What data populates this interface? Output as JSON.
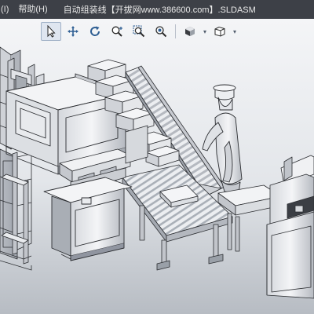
{
  "menu": {
    "items": [
      "(I)",
      "帮助(H)"
    ],
    "document_title": "自动组装线【开拔网www.386600.com】.SLDASM"
  },
  "heads_up_toolbar": {
    "tools": [
      {
        "name": "select",
        "icon": "cursor-arrow-icon",
        "active": true
      },
      {
        "name": "move",
        "icon": "pan-arrows-icon",
        "active": false
      },
      {
        "name": "rotate",
        "icon": "rotate-view-icon",
        "active": false
      },
      {
        "name": "zoom-in-out",
        "icon": "zoom-in-out-icon",
        "active": false
      },
      {
        "name": "zoom-to-area",
        "icon": "zoom-area-icon",
        "active": false
      },
      {
        "name": "zoom-to-fit",
        "icon": "zoom-fit-icon",
        "active": false
      },
      {
        "name": "display-style",
        "icon": "display-style-icon",
        "active": false
      },
      {
        "name": "view-orientation",
        "icon": "view-cube-icon",
        "active": false
      }
    ]
  },
  "colors": {
    "menubar": "#3d4047",
    "menu_text": "#e6e6e6",
    "viewport_top": "#f4f5f7",
    "viewport_bottom": "#b7bcc3",
    "model_fill": "#e4e6ea",
    "model_edge": "#2b2d31"
  }
}
